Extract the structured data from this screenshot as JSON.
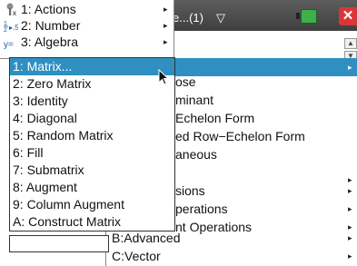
{
  "title_bar": {
    "doc_tab_label": "e...(1)",
    "doc_tab_chevron": "▽",
    "icons": [
      "battery-icon",
      "close-icon"
    ],
    "close_label": "✕"
  },
  "main_menu": {
    "items": [
      {
        "label": "1: Actions",
        "icon": "actions-icon",
        "has_submenu": true
      },
      {
        "label": "2: Number",
        "icon": "number-icon",
        "has_submenu": true
      },
      {
        "label": "3: Algebra",
        "icon": "algebra-icon",
        "has_submenu": true
      }
    ]
  },
  "scroll": {
    "up": "▲",
    "down": "▼"
  },
  "sub_menu": {
    "items": [
      {
        "label": "ose",
        "has_submenu": false
      },
      {
        "label": "minant",
        "has_submenu": false
      },
      {
        "label": "Echelon Form",
        "has_submenu": false
      },
      {
        "label": "ed Row−Echelon Form",
        "has_submenu": false
      },
      {
        "label": "aneous",
        "has_submenu": false
      },
      {
        "label": "",
        "has_submenu": false
      },
      {
        "label": "sions",
        "has_submenu": true
      },
      {
        "label": "perations",
        "has_submenu": true
      },
      {
        "label": "nt Operations",
        "has_submenu": true
      },
      {
        "label": "B:Advanced",
        "has_submenu": true
      },
      {
        "label": "C:Vector",
        "has_submenu": true
      }
    ],
    "arrow": "▸"
  },
  "third_menu": {
    "items": [
      {
        "label": "1: Matrix...",
        "selected": true
      },
      {
        "label": "2: Zero Matrix",
        "selected": false
      },
      {
        "label": "3: Identity",
        "selected": false
      },
      {
        "label": "4: Diagonal",
        "selected": false
      },
      {
        "label": "5: Random Matrix",
        "selected": false
      },
      {
        "label": "6: Fill",
        "selected": false
      },
      {
        "label": "7: Submatrix",
        "selected": false
      },
      {
        "label": "8: Augment",
        "selected": false
      },
      {
        "label": "9: Column Augment",
        "selected": false
      },
      {
        "label": "A: Construct Matrix",
        "selected": false
      }
    ]
  },
  "colors": {
    "highlight": "#2f8fc0",
    "titlebar": "#4a4a4a",
    "close": "#d9363a",
    "battery": "#3db04a"
  }
}
